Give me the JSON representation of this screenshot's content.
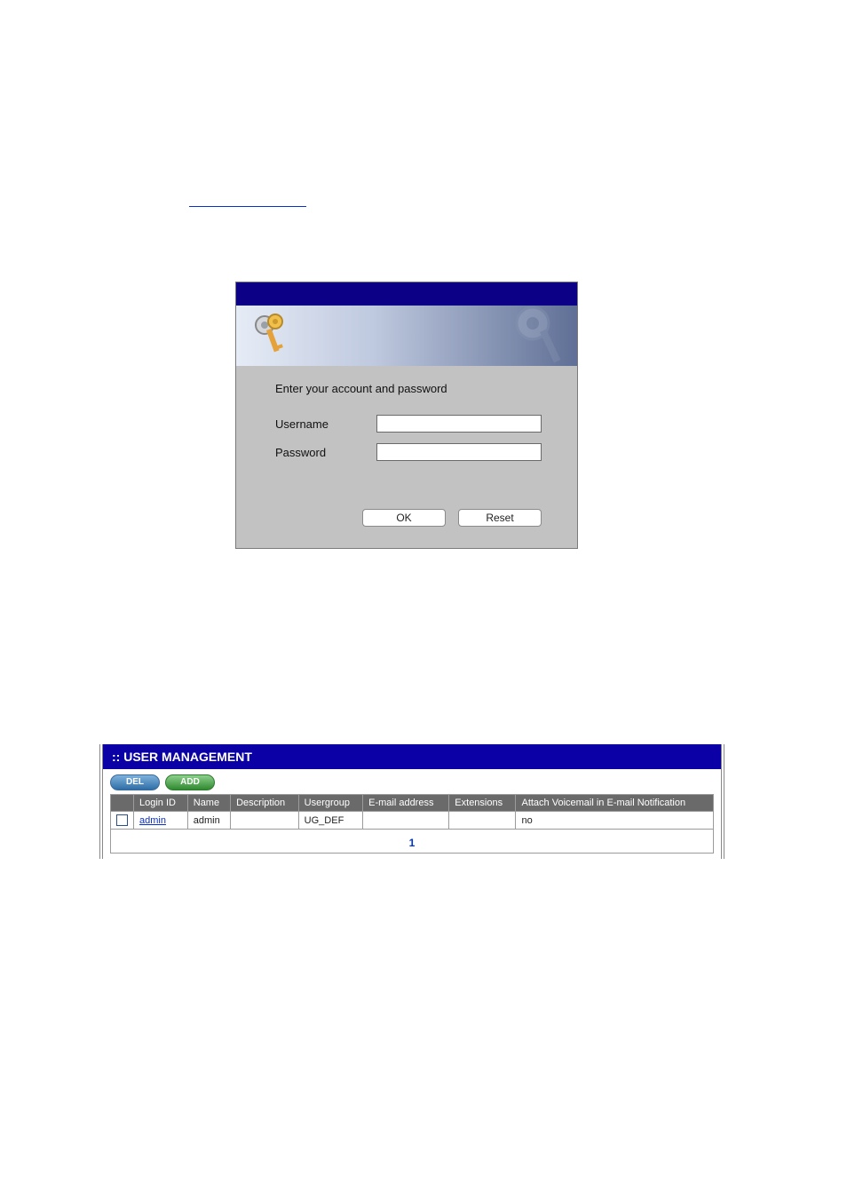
{
  "login": {
    "prompt": "Enter your account and password",
    "username_label": "Username",
    "password_label": "Password",
    "username_value": "",
    "password_value": "",
    "ok_label": "OK",
    "reset_label": "Reset"
  },
  "user_mgmt": {
    "title": ":: USER MANAGEMENT",
    "buttons": {
      "del": "DEL",
      "add": "ADD"
    },
    "columns": {
      "login_id": "Login ID",
      "name": "Name",
      "description": "Description",
      "usergroup": "Usergroup",
      "email": "E-mail address",
      "extensions": "Extensions",
      "attach": "Attach Voicemail in E-mail Notification"
    },
    "rows": [
      {
        "login_id": "admin",
        "name": "admin",
        "description": "",
        "usergroup": "UG_DEF",
        "email": "",
        "extensions": "",
        "attach": "no"
      }
    ],
    "pager": {
      "current": "1"
    }
  }
}
